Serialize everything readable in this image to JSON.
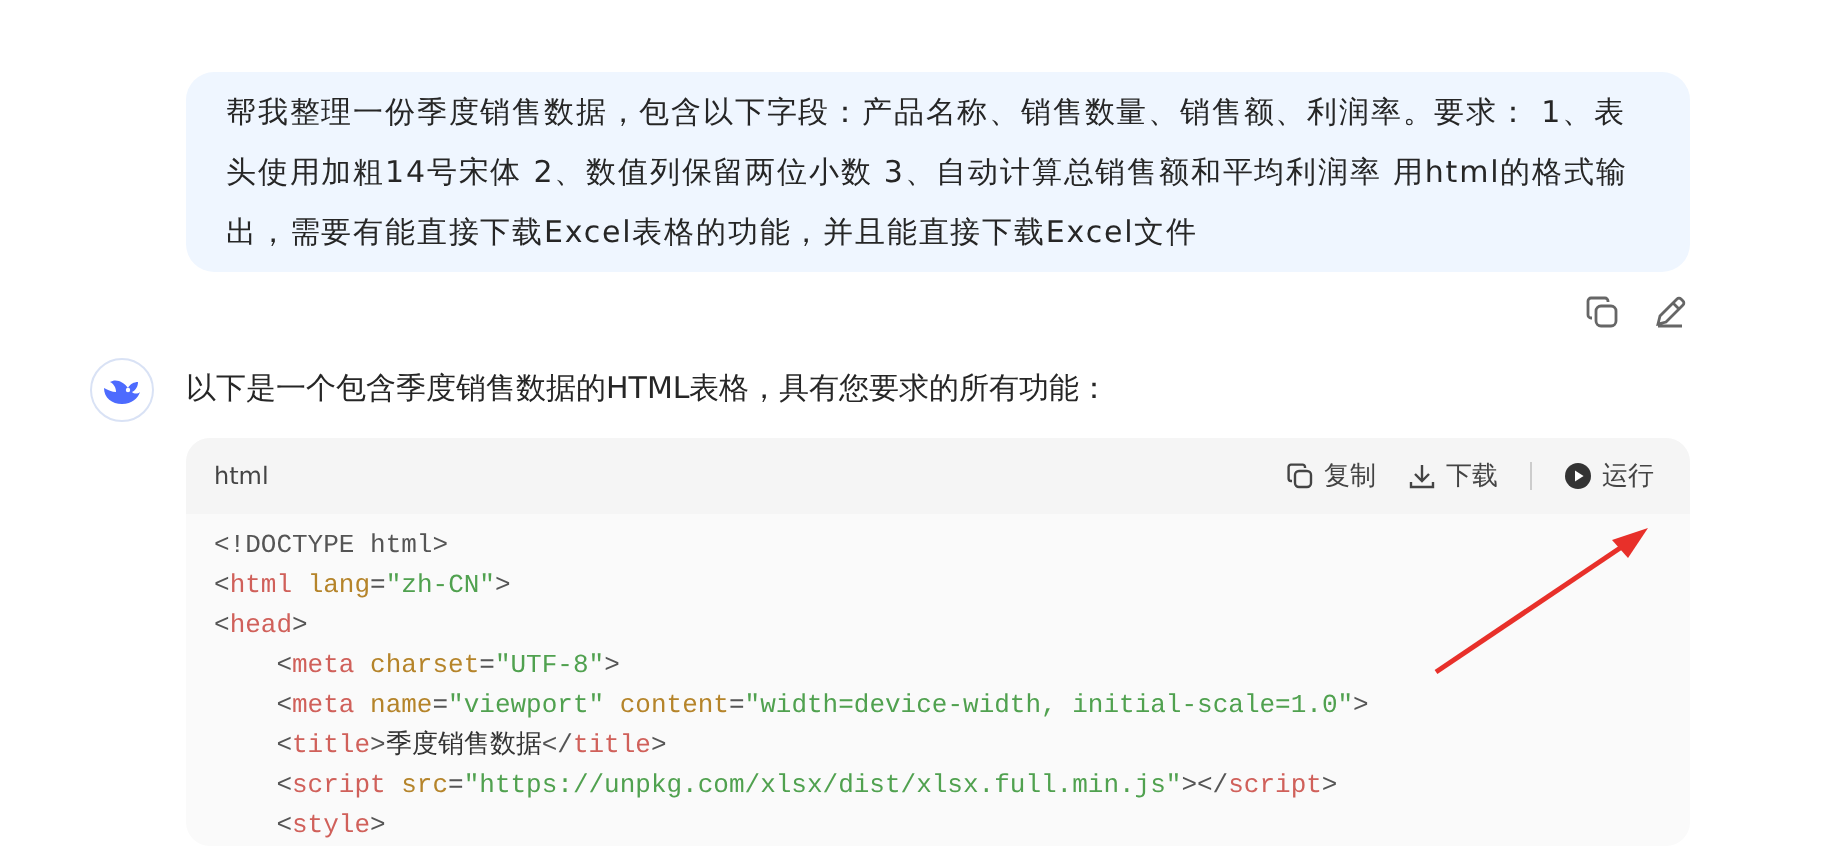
{
  "user_message": {
    "text": "帮我整理一份季度销售数据，包含以下字段：产品名称、销售数量、销售额、利润率。要求： 1、表头使用加粗14号宋体 2、数值列保留两位小数 3、自动计算总销售额和平均利润率 用html的格式输出，需要有能直接下载Excel表格的功能，并且能直接下载Excel文件"
  },
  "assistant_message": {
    "text": "以下是一个包含季度销售数据的HTML表格，具有您要求的所有功能："
  },
  "code_block": {
    "language": "html",
    "actions": [
      {
        "kind": "copy",
        "label": "复制"
      },
      {
        "kind": "download",
        "label": "下载"
      },
      {
        "kind": "run",
        "label": "运行"
      }
    ],
    "lines": [
      {
        "tokens": [
          {
            "kind": "punct",
            "text": "<!DOCTYPE html>"
          }
        ]
      },
      {
        "tokens": [
          {
            "kind": "punct",
            "text": "<"
          },
          {
            "kind": "tag",
            "text": "html"
          },
          {
            "kind": "attr",
            "text": " lang"
          },
          {
            "kind": "punct",
            "text": "="
          },
          {
            "kind": "string",
            "text": "\"zh-CN\""
          },
          {
            "kind": "punct",
            "text": ">"
          }
        ]
      },
      {
        "tokens": [
          {
            "kind": "punct",
            "text": "<"
          },
          {
            "kind": "tag",
            "text": "head"
          },
          {
            "kind": "punct",
            "text": ">"
          }
        ],
        "children": [
          {
            "tokens": [
              {
                "kind": "punct",
                "text": "<"
              },
              {
                "kind": "tag",
                "text": "meta"
              },
              {
                "kind": "attr",
                "text": " charset"
              },
              {
                "kind": "punct",
                "text": "="
              },
              {
                "kind": "string",
                "text": "\"UTF-8\""
              },
              {
                "kind": "punct",
                "text": ">"
              }
            ]
          },
          {
            "tokens": [
              {
                "kind": "punct",
                "text": "<"
              },
              {
                "kind": "tag",
                "text": "meta"
              },
              {
                "kind": "attr",
                "text": " name"
              },
              {
                "kind": "punct",
                "text": "="
              },
              {
                "kind": "string",
                "text": "\"viewport\""
              },
              {
                "kind": "attr",
                "text": " content"
              },
              {
                "kind": "punct",
                "text": "="
              },
              {
                "kind": "string",
                "text": "\"width=device-width, initial-scale=1.0\""
              },
              {
                "kind": "punct",
                "text": ">"
              }
            ]
          },
          {
            "tokens": [
              {
                "kind": "punct",
                "text": "<"
              },
              {
                "kind": "tag",
                "text": "title"
              },
              {
                "kind": "punct",
                "text": ">"
              },
              {
                "kind": "text",
                "text": "季度销售数据"
              },
              {
                "kind": "punct",
                "text": "</"
              },
              {
                "kind": "tag",
                "text": "title"
              },
              {
                "kind": "punct",
                "text": ">"
              }
            ]
          },
          {
            "tokens": [
              {
                "kind": "punct",
                "text": "<"
              },
              {
                "kind": "tag",
                "text": "script"
              },
              {
                "kind": "attr",
                "text": " src"
              },
              {
                "kind": "punct",
                "text": "="
              },
              {
                "kind": "string",
                "text": "\"https://unpkg.com/xlsx/dist/xlsx.full.min.js\""
              },
              {
                "kind": "punct",
                "text": "></"
              },
              {
                "kind": "tag",
                "text": "script"
              },
              {
                "kind": "punct",
                "text": ">"
              }
            ]
          },
          {
            "tokens": [
              {
                "kind": "punct",
                "text": "<"
              },
              {
                "kind": "tag",
                "text": "style"
              },
              {
                "kind": "punct",
                "text": ">"
              }
            ]
          }
        ]
      }
    ]
  }
}
